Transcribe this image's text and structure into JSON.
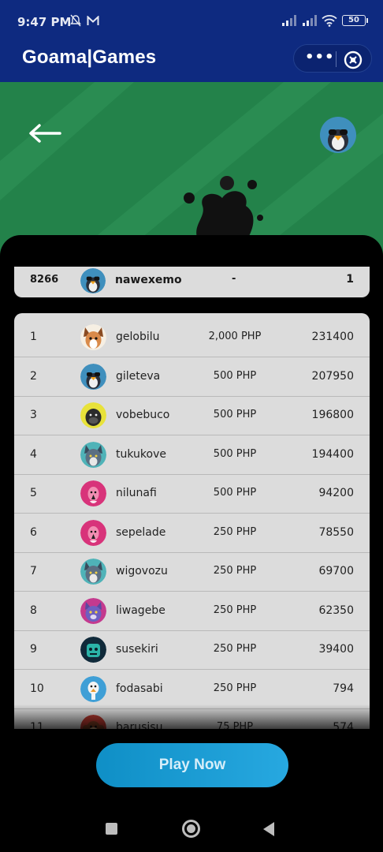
{
  "status_bar": {
    "time": "9:47 PM",
    "battery": "50",
    "icons": [
      "mute-icon",
      "mail-icon",
      "signal-icon",
      "signal-icon",
      "wifi-icon",
      "battery-icon"
    ]
  },
  "app_bar": {
    "title": "Goama|Games",
    "more_label": "•••",
    "icons": [
      "more-icon",
      "close-circle-icon"
    ]
  },
  "hero": {
    "icons": [
      "back-arrow-icon",
      "avatar-penguin",
      "splash-decoration"
    ]
  },
  "my_entry": {
    "rank": "8266",
    "name": "nawexemo",
    "prize": "-",
    "score": "1",
    "avatar": "penguin"
  },
  "leaderboard": {
    "rows": [
      {
        "rank": "1",
        "name": "gelobilu",
        "prize": "2,000 PHP",
        "score": "231400",
        "avatar": "fox"
      },
      {
        "rank": "2",
        "name": "gileteva",
        "prize": "500 PHP",
        "score": "207950",
        "avatar": "penguin"
      },
      {
        "rank": "3",
        "name": "vobebuco",
        "prize": "500 PHP",
        "score": "196800",
        "avatar": "gorilla"
      },
      {
        "rank": "4",
        "name": "tukukove",
        "prize": "500 PHP",
        "score": "194400",
        "avatar": "wolf"
      },
      {
        "rank": "5",
        "name": "nilunafi",
        "prize": "500 PHP",
        "score": "94200",
        "avatar": "flamingo"
      },
      {
        "rank": "6",
        "name": "sepelade",
        "prize": "250 PHP",
        "score": "78550",
        "avatar": "flamingo"
      },
      {
        "rank": "7",
        "name": "wigovozu",
        "prize": "250 PHP",
        "score": "69700",
        "avatar": "wolf"
      },
      {
        "rank": "8",
        "name": "liwagebe",
        "prize": "250 PHP",
        "score": "62350",
        "avatar": "cat"
      },
      {
        "rank": "9",
        "name": "susekiri",
        "prize": "250 PHP",
        "score": "39400",
        "avatar": "robot"
      },
      {
        "rank": "10",
        "name": "fodasabi",
        "prize": "250 PHP",
        "score": "794",
        "avatar": "ostrich"
      },
      {
        "rank": "11",
        "name": "barusisu",
        "prize": "75 PHP",
        "score": "574",
        "avatar": "monkey"
      }
    ]
  },
  "cta": {
    "label": "Play Now"
  },
  "nav_bar": {
    "icons": [
      "recents-icon",
      "home-icon",
      "back-icon"
    ]
  },
  "colors": {
    "app_bar": "#0e2a80",
    "hero": "#23824a",
    "row_bg": "#dcdcdc",
    "cta": "#1a9ed6"
  }
}
